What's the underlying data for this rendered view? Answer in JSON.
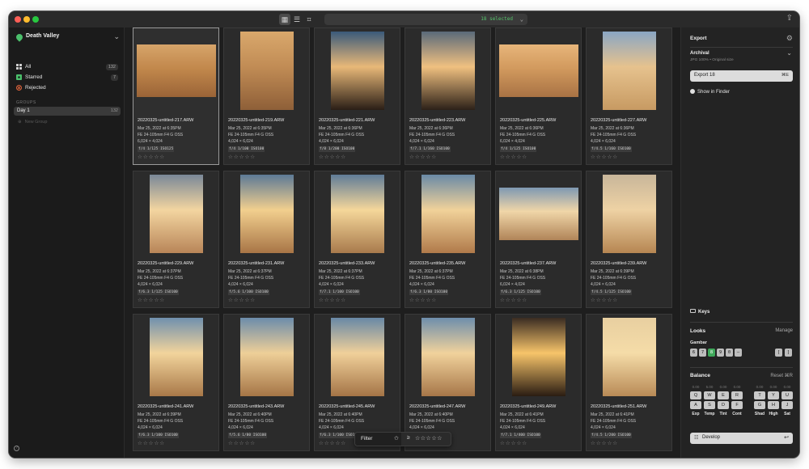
{
  "topbar": {
    "selected_label": "18 selected"
  },
  "sidebar": {
    "library_name": "Death Valley",
    "items": [
      {
        "label": "All",
        "count": "132",
        "icon": "grid-icon",
        "color": "#cfcfcf"
      },
      {
        "label": "Starred",
        "count": "7",
        "icon": "star-square-icon",
        "color": "#4bbf6b"
      },
      {
        "label": "Rejected",
        "count": "",
        "icon": "reject-circle-icon",
        "color": "#e0643c"
      }
    ],
    "groups_header": "GROUPS",
    "groups": [
      {
        "label": "Day 1",
        "count": "132"
      }
    ],
    "new_group": "New Group"
  },
  "photos": [
    {
      "name": "20220325-untitled-217.ARW",
      "date": "Mar 25, 2022 at 6:35PM",
      "lens": "FE 24-105mm F4 G OSS",
      "dims": "6,024 × 4,024",
      "exif": "f/4 1/125 ISO125",
      "selected": true,
      "orientation": "landscape",
      "palette": [
        "#d6a46a",
        "#c2884c",
        "#9a6437"
      ]
    },
    {
      "name": "20220325-untitled-219.ARW",
      "date": "Mar 25, 2022 at 6:35PM",
      "lens": "FE 24-105mm F4 G OSS",
      "dims": "4,024 × 6,024",
      "exif": "f/4 1/100 ISO100",
      "selected": false,
      "orientation": "portrait",
      "palette": [
        "#d9a86c",
        "#c18c55",
        "#8e5f38"
      ]
    },
    {
      "name": "20220325-untitled-221.ARW",
      "date": "Mar 25, 2022 at 6:36PM",
      "lens": "FE 24-105mm F4 G OSS",
      "dims": "4,024 × 6,024",
      "exif": "f/8 1/200 ISO100",
      "selected": false,
      "orientation": "portrait",
      "palette": [
        "#3a5a7a",
        "#e8b878",
        "#2a1e16"
      ]
    },
    {
      "name": "20220325-untitled-223.ARW",
      "date": "Mar 25, 2022 at 6:36PM",
      "lens": "FE 24-105mm F4 G OSS",
      "dims": "4,024 × 6,024",
      "exif": "f/7.1 1/160 ISO100",
      "selected": false,
      "orientation": "portrait",
      "palette": [
        "#5a6a7a",
        "#f0c080",
        "#2c2018"
      ]
    },
    {
      "name": "20220325-untitled-225.ARW",
      "date": "Mar 25, 2022 at 6:36PM",
      "lens": "FE 24-105mm F4 G OSS",
      "dims": "6,024 × 4,024",
      "exif": "f/4 1/125 ISO100",
      "selected": false,
      "orientation": "landscape",
      "palette": [
        "#e7b57a",
        "#d29a5e",
        "#a87244"
      ]
    },
    {
      "name": "20220325-untitled-227.ARW",
      "date": "Mar 25, 2022 at 6:36PM",
      "lens": "FE 24-105mm F4 G OSS",
      "dims": "4,024 × 6,024",
      "exif": "f/4.5 1/160 ISO100",
      "selected": false,
      "orientation": "portrait",
      "palette": [
        "#8aa6c4",
        "#e6c28e",
        "#c79a62"
      ]
    },
    {
      "name": "20220325-untitled-229.ARW",
      "date": "Mar 25, 2022 at 6:37PM",
      "lens": "FE 24-105mm F4 G OSS",
      "dims": "4,024 × 6,024",
      "exif": "f/6.3 1/125 ISO100",
      "selected": false,
      "orientation": "portrait",
      "palette": [
        "#7a8898",
        "#f3d5a0",
        "#b88558"
      ]
    },
    {
      "name": "20220325-untitled-231.ARW",
      "date": "Mar 25, 2022 at 6:37PM",
      "lens": "FE 24-105mm F4 G OSS",
      "dims": "4,024 × 6,024",
      "exif": "f/5.6 1/100 ISO100",
      "selected": false,
      "orientation": "portrait",
      "palette": [
        "#5d7a96",
        "#f2cf8e",
        "#a87546"
      ]
    },
    {
      "name": "20220325-untitled-233.ARW",
      "date": "Mar 25, 2022 at 6:37PM",
      "lens": "FE 24-105mm F4 G OSS",
      "dims": "4,024 × 6,024",
      "exif": "f/7.1 1/100 ISO100",
      "selected": false,
      "orientation": "portrait",
      "palette": [
        "#607c98",
        "#f5d79a",
        "#a87a4c"
      ]
    },
    {
      "name": "20220325-untitled-235.ARW",
      "date": "Mar 25, 2022 at 6:37PM",
      "lens": "FE 24-105mm F4 G OSS",
      "dims": "4,024 × 6,024",
      "exif": "f/6.3 1/80 ISO100",
      "selected": false,
      "orientation": "portrait",
      "palette": [
        "#6a8aa6",
        "#f1d29a",
        "#b07a4a"
      ]
    },
    {
      "name": "20220325-untitled-237.ARW",
      "date": "Mar 25, 2022 at 6:38PM",
      "lens": "FE 24-105mm F4 G OSS",
      "dims": "6,024 × 4,024",
      "exif": "f/6.3 1/125 ISO100",
      "selected": false,
      "orientation": "landscape",
      "palette": [
        "#7e98b2",
        "#f0d6a8",
        "#b08458"
      ]
    },
    {
      "name": "20220325-untitled-239.ARW",
      "date": "Mar 25, 2022 at 6:39PM",
      "lens": "FE 24-105mm F4 G OSS",
      "dims": "4,024 × 6,024",
      "exif": "f/4.5 1/125 ISO100",
      "selected": false,
      "orientation": "portrait",
      "palette": [
        "#c8b69a",
        "#eed2a4",
        "#b68652"
      ]
    },
    {
      "name": "20220325-untitled-241.ARW",
      "date": "Mar 25, 2022 at 6:39PM",
      "lens": "FE 24-105mm F4 G OSS",
      "dims": "4,024 × 6,024",
      "exif": "f/6.3 1/100 ISO100",
      "selected": false,
      "orientation": "portrait",
      "palette": [
        "#7090ae",
        "#f2d49c",
        "#a87848"
      ]
    },
    {
      "name": "20220325-untitled-243.ARW",
      "date": "Mar 25, 2022 at 6:40PM",
      "lens": "FE 24-105mm F4 G OSS",
      "dims": "4,024 × 6,024",
      "exif": "f/5.6 1/80 ISO100",
      "selected": false,
      "orientation": "portrait",
      "palette": [
        "#6c8cab",
        "#eecf98",
        "#a57546"
      ]
    },
    {
      "name": "20220325-untitled-245.ARW",
      "date": "Mar 25, 2022 at 6:40PM",
      "lens": "FE 24-105mm F4 G OSS",
      "dims": "4,024 × 6,024",
      "exif": "f/6.3 1/100 ISO100",
      "selected": false,
      "orientation": "portrait",
      "palette": [
        "#6888a6",
        "#f0d09a",
        "#a47446"
      ]
    },
    {
      "name": "20220325-untitled-247.ARW",
      "date": "Mar 25, 2022 at 6:40PM",
      "lens": "FE 24-105mm F4 G OSS",
      "dims": "4,024 × 6,024",
      "exif": "f/6.3 1/80 ISO100",
      "selected": false,
      "orientation": "portrait",
      "palette": [
        "#6e8eac",
        "#f1d29c",
        "#a67648"
      ]
    },
    {
      "name": "20220325-untitled-249.ARW",
      "date": "Mar 25, 2022 at 6:41PM",
      "lens": "FE 24-105mm F4 G OSS",
      "dims": "4,024 × 6,024",
      "exif": "f/7.1 1/400 ISO100",
      "selected": false,
      "orientation": "portrait",
      "palette": [
        "#3a2c22",
        "#f7c46a",
        "#2a1c12"
      ]
    },
    {
      "name": "20220325-untitled-251.ARW",
      "date": "Mar 25, 2022 at 6:41PM",
      "lens": "FE 24-105mm F4 G OSS",
      "dims": "4,024 × 6,024",
      "exif": "f/4.5 1/200 ISO100",
      "selected": false,
      "orientation": "portrait",
      "palette": [
        "#e8cfa0",
        "#f5dca8",
        "#b88a56"
      ]
    }
  ],
  "filter": {
    "label": "Filter",
    "op": "≥",
    "stars": "☆☆☆☆☆"
  },
  "export_panel": {
    "title": "Export",
    "preset": "Archival",
    "preset_desc": "JPG 100% • Original size",
    "export_button": "Export 18",
    "export_shortcut": "⌘E",
    "show_in_finder": "Show in Finder"
  },
  "keys_label": "Keys",
  "looks": {
    "title": "Looks",
    "manage": "Manage",
    "set_name": "Gambar",
    "keys": [
      "6",
      "7",
      "8",
      "9",
      "0",
      "—"
    ],
    "active_key": "8",
    "nav_keys": [
      "[",
      "]"
    ]
  },
  "balance": {
    "title": "Balance",
    "reset": "Reset ⌘R",
    "columns": [
      {
        "value": "0.00",
        "up": "Q",
        "down": "A",
        "label": "Exp"
      },
      {
        "value": "5.00",
        "up": "W",
        "down": "S",
        "label": "Temp"
      },
      {
        "value": "0.00",
        "up": "E",
        "down": "D",
        "label": "Tint"
      },
      {
        "value": "0.00",
        "up": "R",
        "down": "F",
        "label": "Cont"
      },
      {
        "value": "0.00",
        "up": "T",
        "down": "G",
        "label": "Shad"
      },
      {
        "value": "0.00",
        "up": "Y",
        "down": "H",
        "label": "High"
      },
      {
        "value": "0.00",
        "up": "U",
        "down": "J",
        "label": "Sat"
      }
    ]
  },
  "develop_button": "Develop",
  "colors": {
    "accent_green": "#4bbf6b",
    "selected_text": "#55c26b"
  }
}
